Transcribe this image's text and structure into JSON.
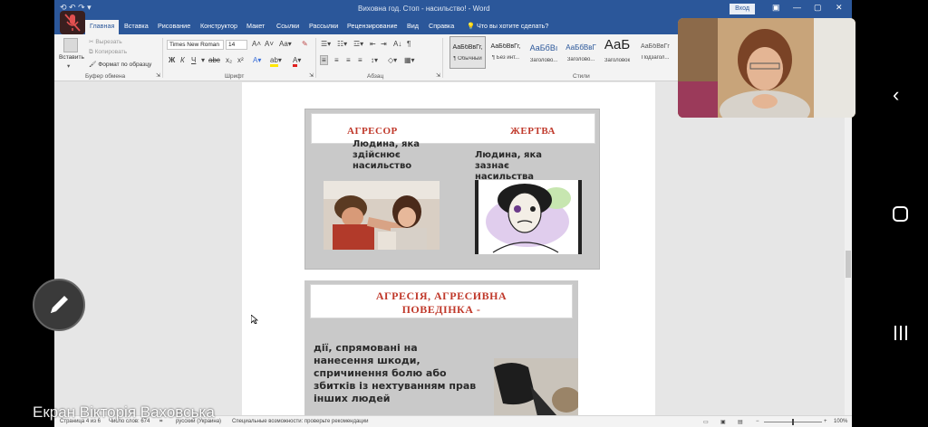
{
  "window": {
    "title": "Виховна год. Стоп - насильство! - Word",
    "signin_label": "Вход"
  },
  "tabs": [
    "Главная",
    "Вставка",
    "Рисование",
    "Конструктор",
    "Макет",
    "Ссылки",
    "Рассылки",
    "Рецензирование",
    "Вид",
    "Справка"
  ],
  "tell_me": "Что вы хотите сделать?",
  "ribbon": {
    "clipboard": {
      "paste_label": "Вставить",
      "cut_label": "Вырезать",
      "copy_label": "Копировать",
      "format_painter_label": "Формат по образцу",
      "group_label": "Буфер обмена"
    },
    "font": {
      "font_name": "Times New Roman",
      "font_size": "14",
      "group_label": "Шрифт"
    },
    "paragraph": {
      "group_label": "Абзац"
    },
    "styles": {
      "items": [
        {
          "sample": "АаБбВвГг,",
          "name": "¶ Обычный"
        },
        {
          "sample": "АаБбВвГг,",
          "name": "¶ Без инт..."
        },
        {
          "sample": "АаБбВı",
          "name": "Заголово..."
        },
        {
          "sample": "АаБбВвГ",
          "name": "Заголово..."
        },
        {
          "sample": "АаБ",
          "name": "Заголовок"
        },
        {
          "sample": "АаБбВвГг",
          "name": "Подзагол..."
        }
      ],
      "group_label": "Стили"
    }
  },
  "document": {
    "slide1": {
      "aggressor_title": "АГРЕСОР",
      "victim_title": "ЖЕРТВА",
      "aggressor_lines": [
        "Людина, яка",
        "здійснює",
        "насильство"
      ],
      "victim_lines": [
        "Людина, яка",
        "зазнає",
        "насильства"
      ]
    },
    "slide2": {
      "title_line1": "АГРЕСІЯ, АГРЕСИВНА",
      "title_line2": "ПОВЕДІНКА -",
      "body_lines": [
        "дії, спрямовані на",
        "нанесення шкоди,",
        "спричинення болю або",
        "збитків із нехтуванням прав",
        "інших людей"
      ]
    }
  },
  "status": {
    "page": "Страница 4 из 6",
    "words": "Число слов: 674",
    "language": "русский (Украина)",
    "accessibility": "Специальные возможности: проверьте рекомендации",
    "zoom": "100%"
  },
  "overlay": {
    "caption": "Екран Вікторія Ваховська"
  }
}
